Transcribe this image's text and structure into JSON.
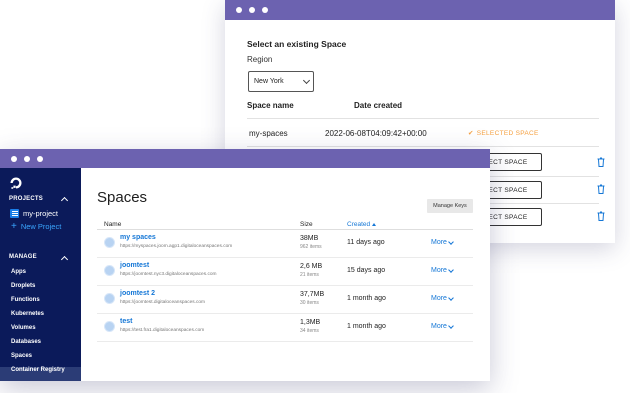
{
  "back_window": {
    "heading": "Select an existing Space",
    "region_label": "Region",
    "region_value": "New York",
    "columns": {
      "name": "Space name",
      "date": "Date created"
    },
    "row": {
      "name": "my-spaces",
      "date": "2022-06-08T04:09:42+00:00"
    },
    "selected_label": "SELECTED SPACE",
    "select_button_label": "ECT SPACE",
    "accent_color": "#f5a040"
  },
  "front_window": {
    "sidebar": {
      "projects_header": "PROJECTS",
      "project_name": "my-project",
      "new_project": "New Project",
      "manage_header": "MANAGE",
      "links": [
        "Apps",
        "Droplets",
        "Functions",
        "Kubernetes",
        "Volumes",
        "Databases",
        "Spaces",
        "Container Registry"
      ],
      "active_link": "Spaces"
    },
    "main": {
      "title": "Spaces",
      "manage_keys": "Manage Keys",
      "columns": {
        "name": "Name",
        "size": "Size",
        "created": "Created"
      },
      "more_label": "More",
      "rows": [
        {
          "name": "my spaces",
          "url": "https://myspaces.joom.agp1.digitaloceanspaces.com",
          "size": "38MB",
          "items": "962 items",
          "created": "11 days ago"
        },
        {
          "name": "joomtest",
          "url": "https://joomtest.nyc3.digitaloceanspaces.com",
          "size": "2,6 MB",
          "items": "21 items",
          "created": "15 days ago"
        },
        {
          "name": "joomtest 2",
          "url": "https://joomtest.digitaloceanspaces.com",
          "size": "37,7MB",
          "items": "30 items",
          "created": "1 month ago"
        },
        {
          "name": "test",
          "url": "https://test.fra1.digitaloceanspaces.com",
          "size": "1,3MB",
          "items": "34 items",
          "created": "1 month ago"
        }
      ]
    },
    "brand_color": "#0b1a5a",
    "link_color": "#1577d6"
  }
}
